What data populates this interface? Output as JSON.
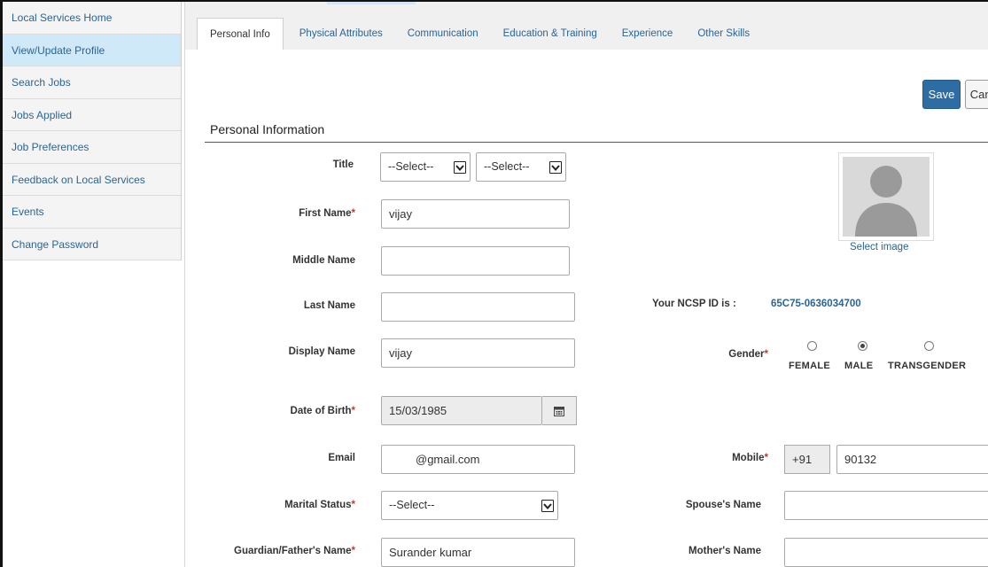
{
  "sidebar": {
    "items": [
      {
        "label": "Local Services Home"
      },
      {
        "label": "View/Update Profile"
      },
      {
        "label": "Search Jobs"
      },
      {
        "label": "Jobs Applied"
      },
      {
        "label": "Job Preferences"
      },
      {
        "label": "Feedback on Local Services"
      },
      {
        "label": "Events"
      },
      {
        "label": "Change Password"
      }
    ],
    "active_index": 1
  },
  "tabs": [
    {
      "label": "Personal Info"
    },
    {
      "label": "Physical Attributes"
    },
    {
      "label": "Communication"
    },
    {
      "label": "Education & Training"
    },
    {
      "label": "Experience"
    },
    {
      "label": "Other Skills"
    }
  ],
  "toolbar": {
    "save_label": "Save",
    "cancel_label": "Cancel"
  },
  "section": {
    "title": "Personal Information"
  },
  "form": {
    "title": {
      "label": "Title",
      "select1": "--Select--",
      "select2": "--Select--"
    },
    "first_name": {
      "label": "First Name",
      "value": "vijay"
    },
    "middle_name": {
      "label": "Middle Name",
      "value": ""
    },
    "last_name": {
      "label": "Last Name",
      "value": ""
    },
    "display_name": {
      "label": "Display Name",
      "value": "vijay"
    },
    "dob": {
      "label": "Date of Birth",
      "value": "15/03/1985"
    },
    "email": {
      "label": "Email",
      "value": "@gmail.com"
    },
    "marital_status": {
      "label": "Marital Status",
      "value": "--Select--"
    },
    "guardian": {
      "label": "Guardian/Father's Name",
      "value": "Surander kumar"
    },
    "ncsp": {
      "label": "Your NCSP ID is :",
      "value": "65C75-0636034700"
    },
    "gender": {
      "label": "Gender",
      "options": [
        {
          "label": "FEMALE",
          "checked": false
        },
        {
          "label": "MALE",
          "checked": true
        },
        {
          "label": "TRANSGENDER",
          "checked": false
        }
      ]
    },
    "mobile": {
      "label": "Mobile",
      "prefix": "+91",
      "value": "90132"
    },
    "spouse": {
      "label": "Spouse's Name",
      "value": ""
    },
    "mother": {
      "label": "Mother's Name",
      "value": ""
    }
  },
  "avatar": {
    "select_label": "Select image"
  },
  "required_mark": "*",
  "colors": {
    "link": "#2a6496",
    "primary": "#2e6da4",
    "active_sidebar": "#cfe9f9",
    "required": "#c0392b"
  }
}
